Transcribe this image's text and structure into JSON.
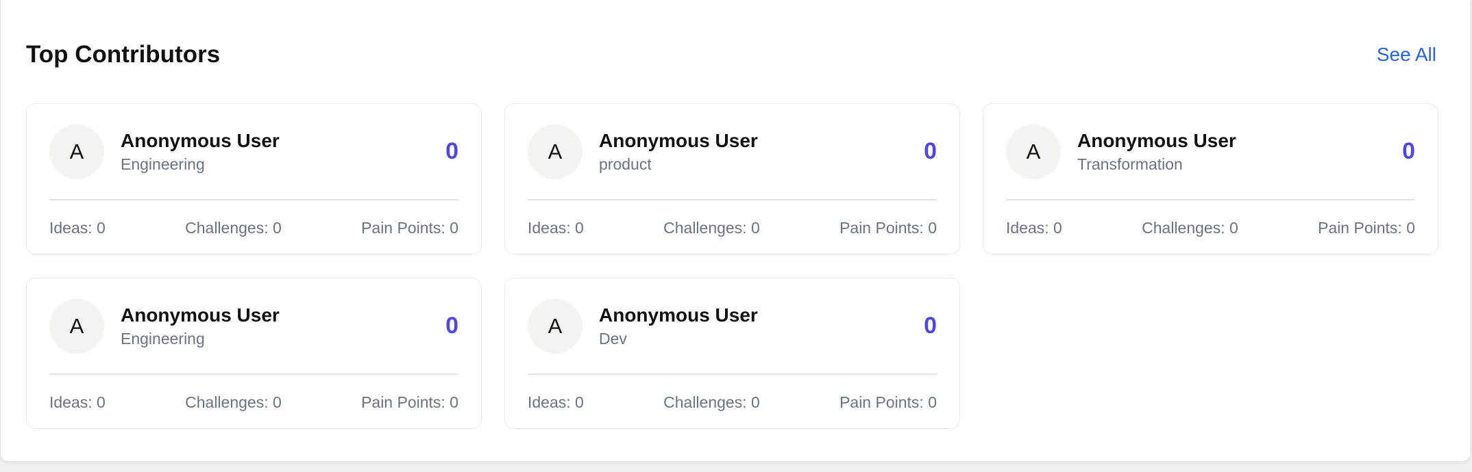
{
  "section": {
    "title": "Top Contributors",
    "see_all_label": "See All"
  },
  "contributors": [
    {
      "initial": "A",
      "name": "Anonymous User",
      "department": "Engineering",
      "score": "0",
      "ideas": "Ideas: 0",
      "challenges": "Challenges: 0",
      "pain_points": "Pain Points: 0"
    },
    {
      "initial": "A",
      "name": "Anonymous User",
      "department": "product",
      "score": "0",
      "ideas": "Ideas: 0",
      "challenges": "Challenges: 0",
      "pain_points": "Pain Points: 0"
    },
    {
      "initial": "A",
      "name": "Anonymous User",
      "department": "Transformation",
      "score": "0",
      "ideas": "Ideas: 0",
      "challenges": "Challenges: 0",
      "pain_points": "Pain Points: 0"
    },
    {
      "initial": "A",
      "name": "Anonymous User",
      "department": "Engineering",
      "score": "0",
      "ideas": "Ideas: 0",
      "challenges": "Challenges: 0",
      "pain_points": "Pain Points: 0"
    },
    {
      "initial": "A",
      "name": "Anonymous User",
      "department": "Dev",
      "score": "0",
      "ideas": "Ideas: 0",
      "challenges": "Challenges: 0",
      "pain_points": "Pain Points: 0"
    }
  ],
  "colors": {
    "accent_score": "#4f46e5",
    "link": "#2563eb",
    "muted_text": "#6b7280"
  }
}
